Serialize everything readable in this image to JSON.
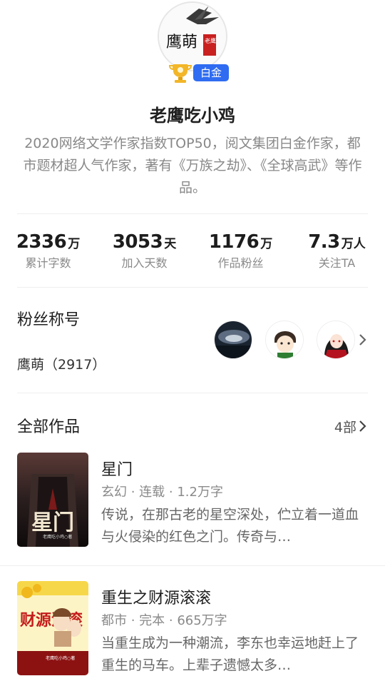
{
  "author": {
    "avatar_text": "鹰萌",
    "avatar_sub": "老鹰",
    "badge_label": "白金",
    "name": "老鹰吃小鸡",
    "bio": "2020网络文学作家指数TOP50，阅文集团白金作家，都市题材超人气作家，著有《万族之劫》、《全球高武》等作品。"
  },
  "stats": [
    {
      "value": "2336",
      "unit": "万",
      "label": "累计字数"
    },
    {
      "value": "3053",
      "unit": "天",
      "label": "加入天数"
    },
    {
      "value": "1176",
      "unit": "万",
      "label": "作品粉丝"
    },
    {
      "value": "7.3",
      "unit": "万人",
      "label": "关注TA"
    }
  ],
  "fans": {
    "title": "粉丝称号",
    "value": "鹰萌（2917）"
  },
  "works": {
    "title": "全部作品",
    "count": "4部",
    "books": [
      {
        "title": "星门",
        "meta": "玄幻 · 连载 · 1.2万字",
        "desc": "传说，在那古老的星空深处，伫立着一道血与火侵染的红色之门。传奇与…",
        "cover_title": "星门",
        "cover_author": "老鹰吃小鸡○著"
      },
      {
        "title": "重生之财源滚滚",
        "meta": "都市 · 完本 · 665万字",
        "desc": "当重生成为一种潮流，李东也幸运地赶上了重生的马车。上辈子遗憾太多…",
        "cover_title": "财源滚滚",
        "cover_author": "老鹰吃小鸡○著"
      }
    ]
  },
  "colors": {
    "badge": "#2f6cf1",
    "gray_text": "#888888"
  }
}
